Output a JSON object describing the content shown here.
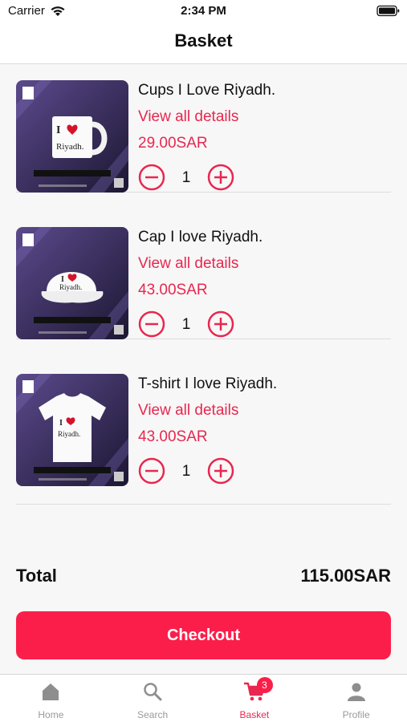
{
  "status_bar": {
    "carrier": "Carrier",
    "time": "2:34 PM"
  },
  "header": {
    "title": "Basket"
  },
  "items": [
    {
      "name": "Cups I Love Riyadh.",
      "details_link": "View all details",
      "price": "29.00SAR",
      "quantity": "1",
      "image_icon": "mug-icon"
    },
    {
      "name": "Cap I love Riyadh.",
      "details_link": "View all details",
      "price": "43.00SAR",
      "quantity": "1",
      "image_icon": "cap-icon"
    },
    {
      "name": "T-shirt I love Riyadh.",
      "details_link": "View all details",
      "price": "43.00SAR",
      "quantity": "1",
      "image_icon": "tshirt-icon"
    }
  ],
  "summary": {
    "total_label": "Total",
    "total_value": "115.00SAR"
  },
  "checkout": {
    "label": "Checkout"
  },
  "tabs": [
    {
      "label": "Home",
      "icon": "home-icon"
    },
    {
      "label": "Search",
      "icon": "search-icon"
    },
    {
      "label": "Basket",
      "icon": "cart-icon",
      "badge": "3",
      "active": true
    },
    {
      "label": "Profile",
      "icon": "profile-icon"
    }
  ],
  "colors": {
    "accent": "#fc1e4a",
    "link": "#e8274f",
    "tab_inactive": "#9a9a9a"
  }
}
